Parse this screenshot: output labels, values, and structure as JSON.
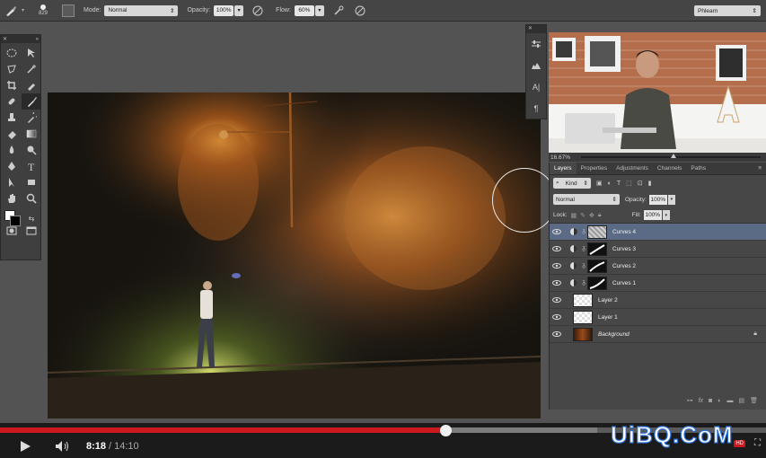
{
  "options_bar": {
    "brush_size": "829",
    "mode_label": "Mode:",
    "mode_value": "Normal",
    "opacity_label": "Opacity:",
    "opacity_value": "100%",
    "flow_label": "Flow:",
    "flow_value": "60%",
    "workspace": "Phlearn"
  },
  "navigator": {
    "zoom": "16.67%"
  },
  "layers_panel": {
    "tabs": [
      "Layers",
      "Properties",
      "Adjustments",
      "Channels",
      "Paths"
    ],
    "kind_label": "Kind",
    "blend_mode": "Normal",
    "opacity_label": "Opacity:",
    "opacity_value": "100%",
    "lock_label": "Lock:",
    "fill_label": "Fill:",
    "fill_value": "100%",
    "layers": [
      {
        "name": "Curves 4",
        "type": "curves-mask",
        "selected": true
      },
      {
        "name": "Curves 3",
        "type": "curves",
        "selected": false
      },
      {
        "name": "Curves 2",
        "type": "curves",
        "selected": false
      },
      {
        "name": "Curves 1",
        "type": "curves",
        "selected": false
      },
      {
        "name": "Layer 2",
        "type": "layer",
        "selected": false
      },
      {
        "name": "Layer 1",
        "type": "layer",
        "selected": false
      },
      {
        "name": "Background",
        "type": "background",
        "selected": false
      }
    ]
  },
  "player": {
    "current_time": "8:18",
    "separator": "/",
    "duration": "14:10",
    "played_fraction": 0.582,
    "loaded_fraction": 0.78,
    "hd_badge": "HD"
  },
  "watermark": "UiBQ.CoM",
  "colors": {
    "progress_red": "#cc181e",
    "selected_layer": "#5c6b85",
    "ui_dark": "#474747"
  }
}
